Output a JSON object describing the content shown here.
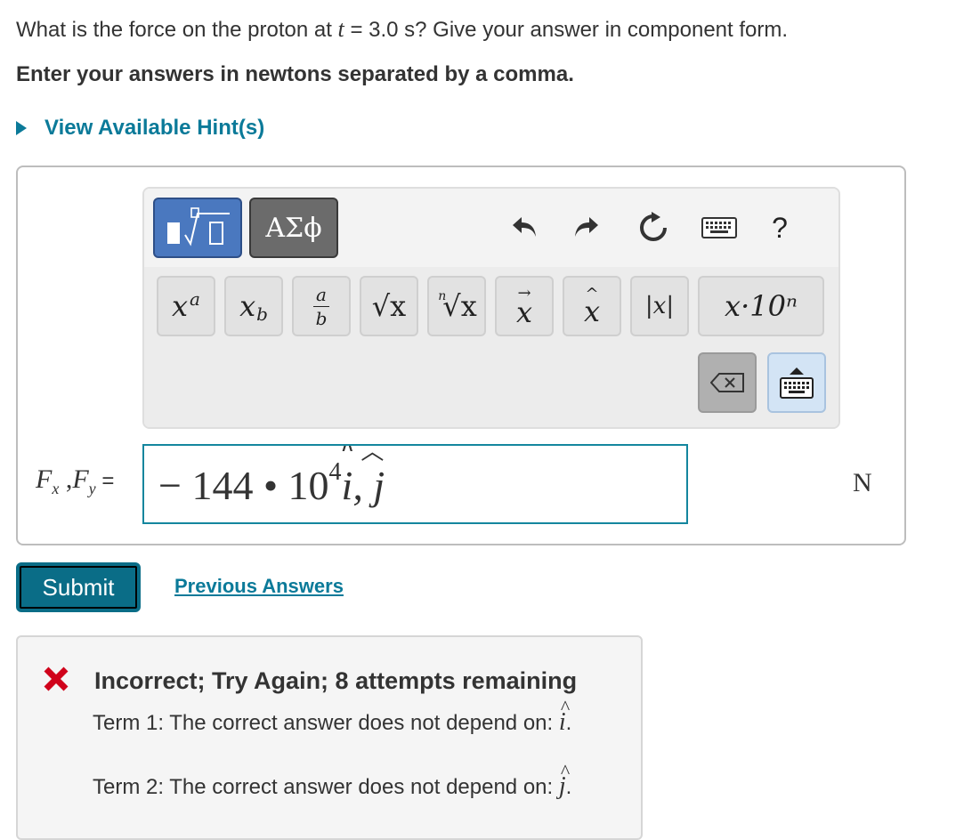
{
  "question": {
    "before": "What is the force on the proton at ",
    "variable": "t",
    "after": " = 3.0 s? Give your answer in component form."
  },
  "instruction": "Enter your answers in newtons separated by a comma.",
  "hint_link": "View Available Hint(s)",
  "toolbar": {
    "symbols_label": "ΑΣϕ",
    "help_label": "?",
    "keys": {
      "power_base": "x",
      "power_exp": "a",
      "subscript_base": "x",
      "subscript_sub": "b",
      "frac_num": "a",
      "frac_den": "b",
      "sqrt": "√x",
      "nthroot_index": "n",
      "nthroot": "√x",
      "vector_base": "x",
      "unitvec_base": "x",
      "abs": "|x|",
      "sci": "x·10ⁿ"
    }
  },
  "answer": {
    "label_f": "F",
    "label_x": "x",
    "label_comma": " ,",
    "label_y": "y",
    "label_eq": " =",
    "value_main": "− 144 • 10",
    "value_exp": "4",
    "value_i": "i",
    "value_sep": ", ",
    "value_j": "j",
    "unit": "N"
  },
  "submit_label": "Submit",
  "previous_answers_label": "Previous Answers",
  "feedback": {
    "title": "Incorrect; Try Again; 8 attempts remaining",
    "line1": "Term 1: The correct answer does not depend on: ",
    "line1_symbol": "i",
    "line2": "Term 2: The correct answer does not depend on: ",
    "line2_symbol": "j",
    "period": "."
  },
  "colors": {
    "accent": "#0b7a99",
    "submit_bg": "#0a6d87",
    "error": "#d0021b",
    "templates_btn": "#4a78bf",
    "symbols_btn": "#6b6b6b"
  }
}
